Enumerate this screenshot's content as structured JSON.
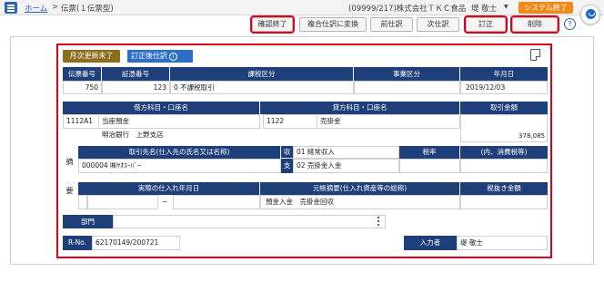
{
  "header": {
    "breadcrumb_home": "ホーム",
    "breadcrumb_sep": ">",
    "breadcrumb_current": "伝票(１伝票型)",
    "company": "(09999/217)株式会社ＴＫＣ食品",
    "user": "堤 敬士",
    "system_end_label": "システム終了"
  },
  "actions": {
    "confirm_end": "確認終了",
    "convert_compound": "複合仕訳に変換",
    "prev_entry": "前仕訳",
    "next_entry": "次仕訳",
    "correct": "訂正",
    "delete": "削除",
    "help": "?"
  },
  "badges": {
    "month_status": "月次更新未了",
    "corrected_entry": "訂正後仕訳"
  },
  "row1": {
    "headers": [
      "伝票番号",
      "証憑番号",
      "課税区分",
      "事業区分",
      "年月日"
    ],
    "voucher_no": "750",
    "evidence_no": "123",
    "tax_class": "0 不課税取引",
    "business_class": "",
    "date": "2019/12/03"
  },
  "accounts": {
    "debit_header": "借方科目・口座名",
    "credit_header": "貸方科目・口座名",
    "amount_header": "取引金額",
    "debit_code": "1112A1",
    "debit_name": "当座預金",
    "debit_sub": "明治銀行　上野支店",
    "credit_code": "1122",
    "credit_name": "売掛金",
    "amount": "378,085"
  },
  "partner": {
    "side_label_1": "摘",
    "side_label_2": "要",
    "header": "取引先名(仕入先の氏名又は名称)",
    "value": "000004 ㈱ﾔｵｽｰﾊﾟｰ",
    "kind_in": "収",
    "kind_out": "支",
    "kind_in_value": "01 経常収入",
    "kind_out_value": "02 売掛金入金",
    "tax_rate_header": "税率",
    "consumption_tax_header": "(内、消費税等)"
  },
  "purchase": {
    "date_header": "実際の仕入れ年月日",
    "range_sep": "~",
    "summary_header": "元帳摘要(仕入れ資産等の総称)",
    "summary_value": "預金入金　売掛金回収",
    "excl_tax_header": "税抜き金額"
  },
  "footer": {
    "dept_label": "部門",
    "rno_label": "R-No.",
    "rno_value": "62170149/200721",
    "entered_by_label": "入力者",
    "entered_by_value": "堤 敬士"
  },
  "colors": {
    "header_navy": "#1f3f7a",
    "highlight_red": "#e0001b",
    "system_end_orange": "#f08a1b",
    "badge_brown": "#8b6d1c",
    "badge_blue": "#2c6fc9"
  }
}
